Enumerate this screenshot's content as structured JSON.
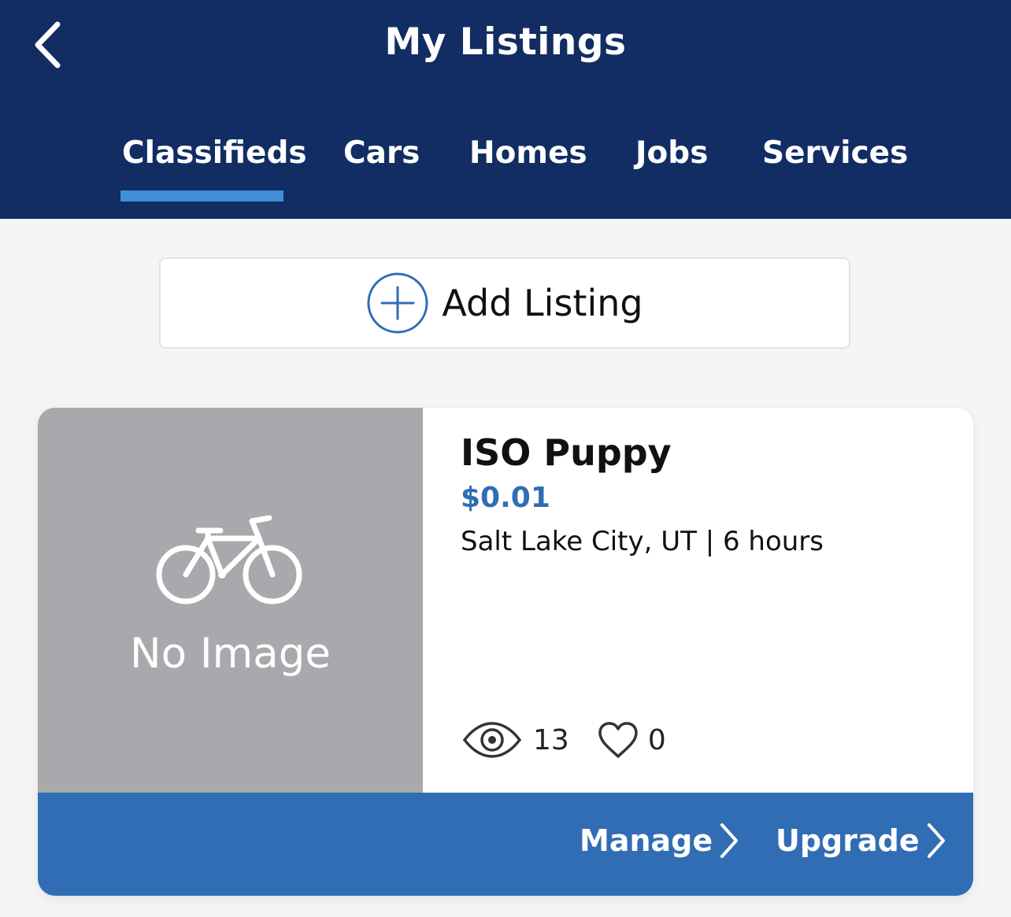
{
  "header": {
    "title": "My Listings",
    "back_icon": "chevron-left-icon"
  },
  "tabs": [
    {
      "label": "Classifieds",
      "active": true
    },
    {
      "label": "Cars",
      "active": false
    },
    {
      "label": "Homes",
      "active": false
    },
    {
      "label": "Jobs",
      "active": false
    },
    {
      "label": "Services",
      "active": false
    }
  ],
  "add_listing": {
    "label": "Add Listing",
    "icon": "plus-circle-icon"
  },
  "listing": {
    "image_placeholder": "No Image",
    "placeholder_icon": "bicycle-icon",
    "title": "ISO Puppy",
    "price": "$0.01",
    "meta": "Salt Lake City, UT | 6 hours",
    "views": "13",
    "likes": "0",
    "actions": {
      "manage_label": "Manage",
      "upgrade_label": "Upgrade"
    }
  },
  "colors": {
    "header_bg": "#112d63",
    "tab_indicator": "#3e8fd6",
    "accent": "#2f6db5",
    "footer_bg": "#306db5",
    "placeholder_bg": "#a8a9ac",
    "page_bg": "#f5f5f5"
  }
}
